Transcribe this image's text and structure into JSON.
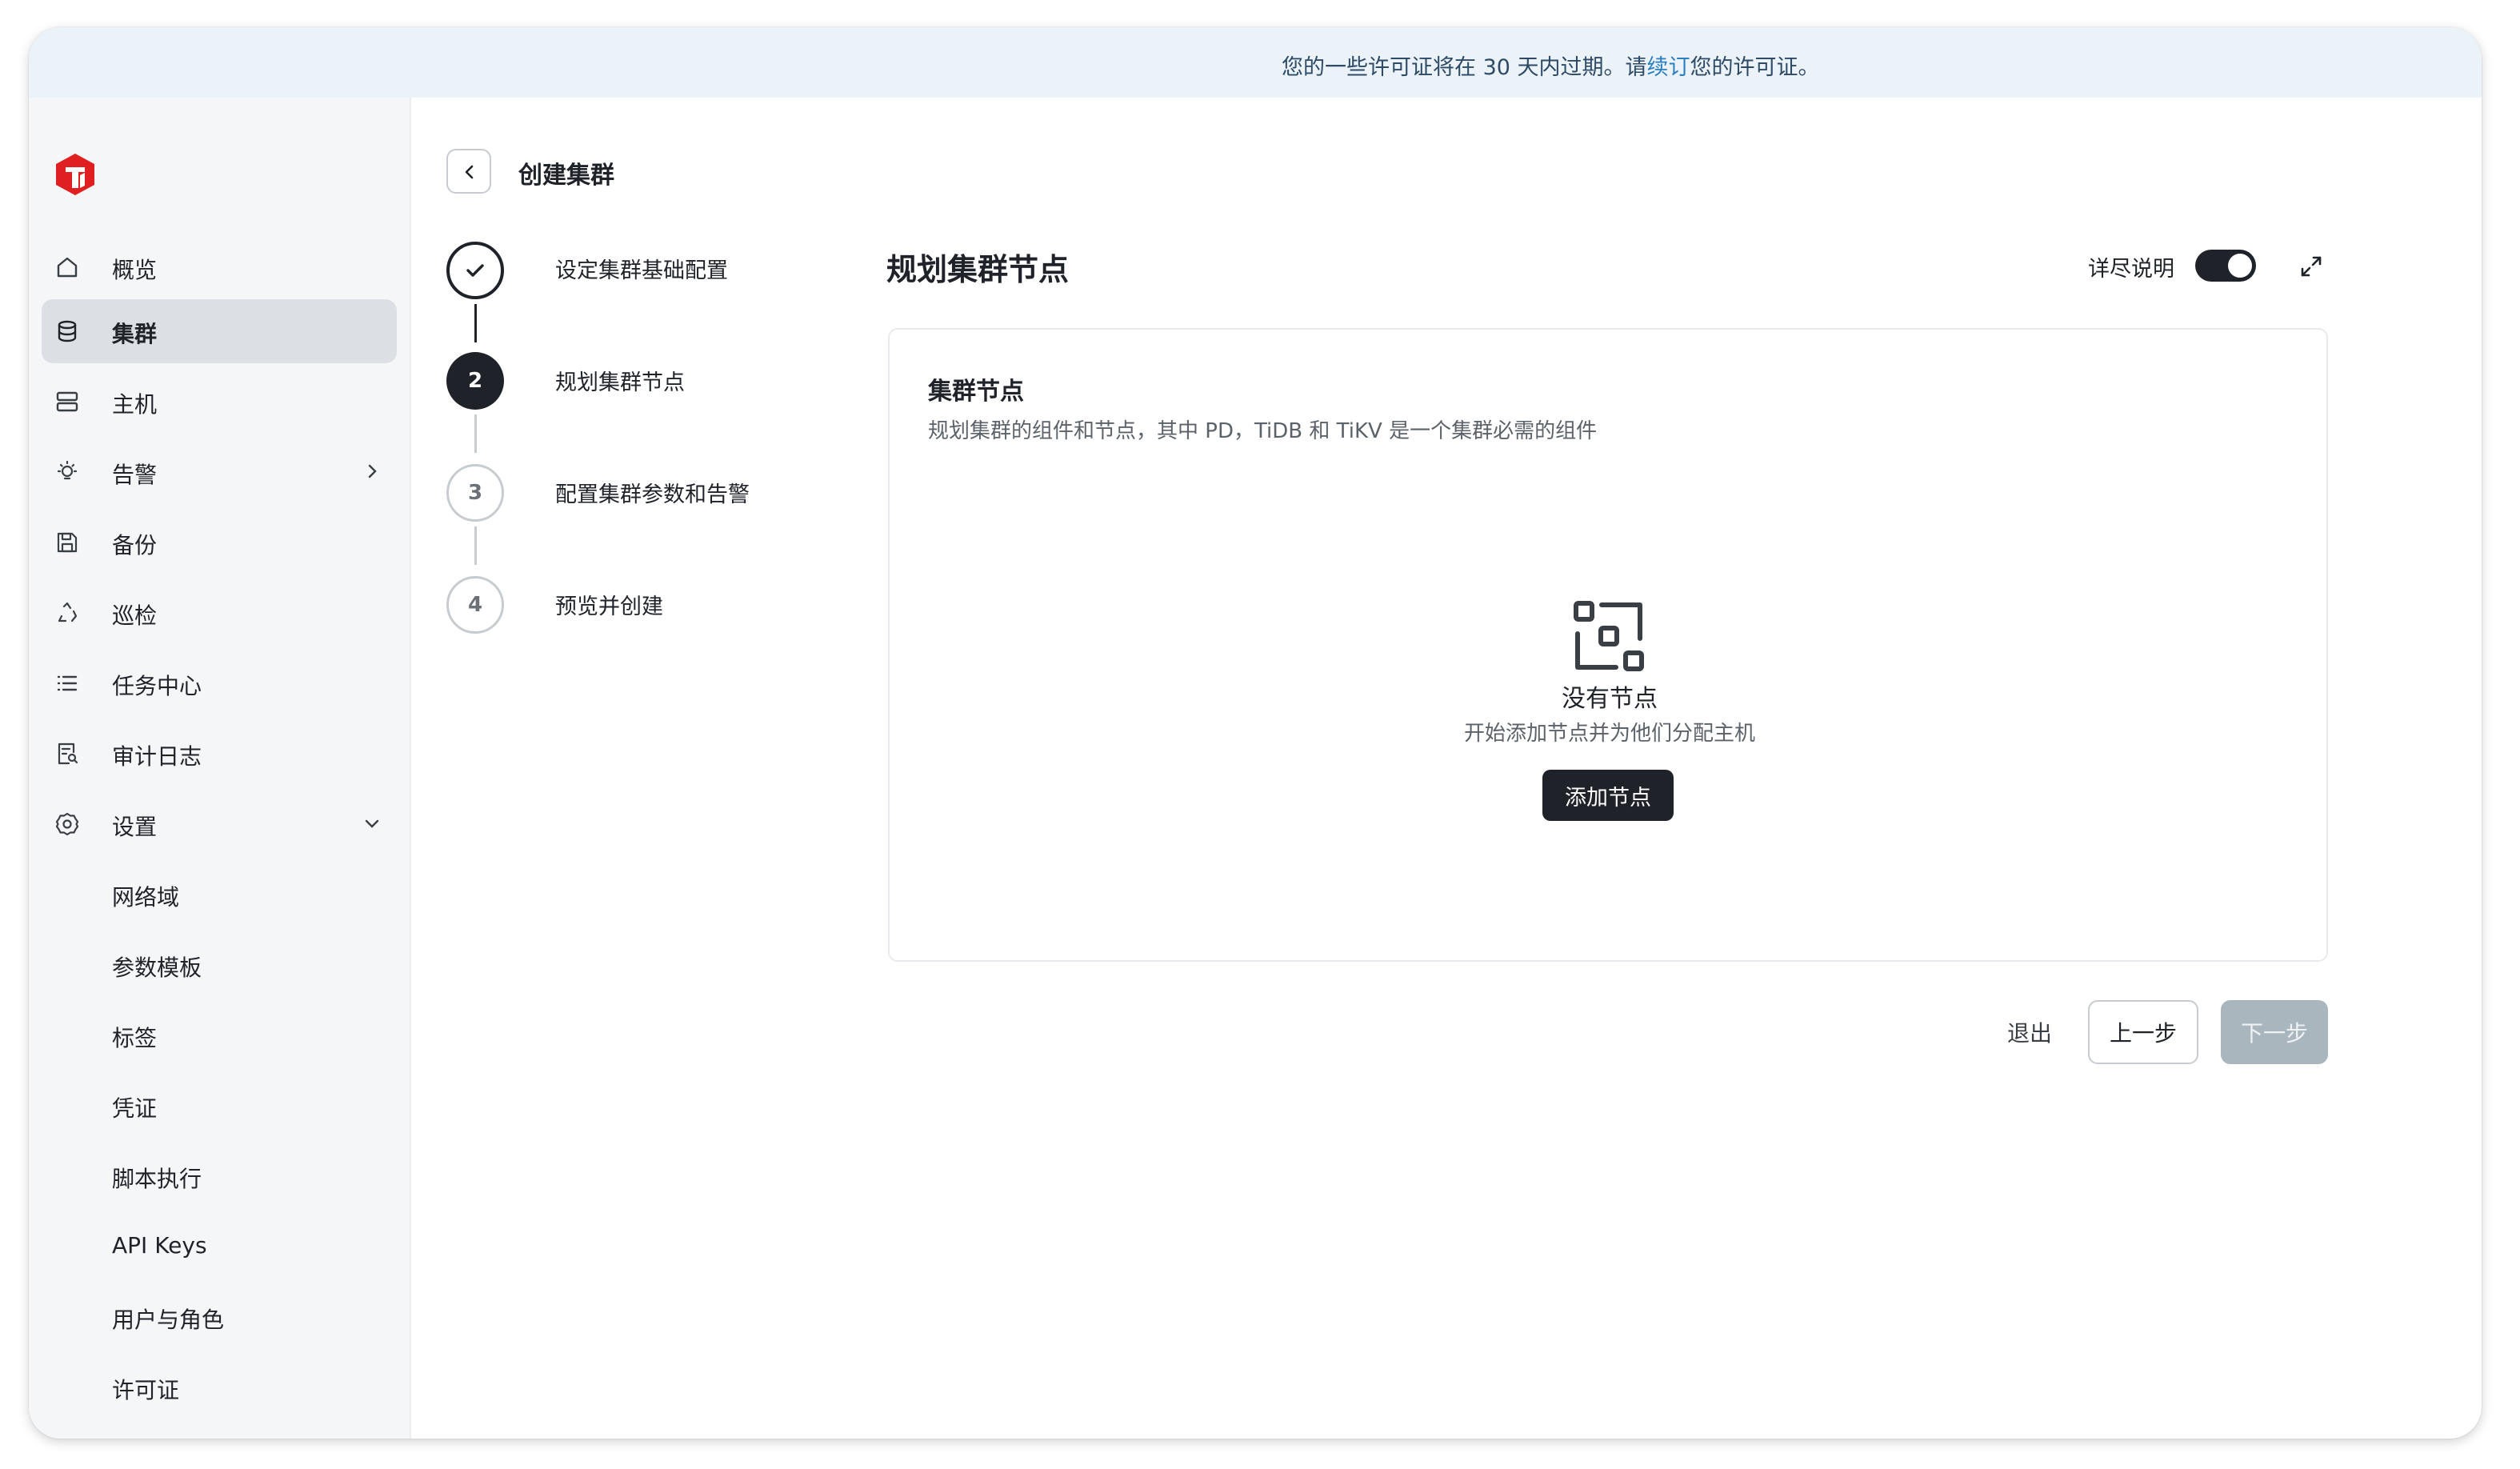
{
  "banner": {
    "text_before": "您的一些许可证将在 30 天内过期。请",
    "link": "续订",
    "text_after": "您的许可证。"
  },
  "colors": {
    "brand": "#e02020",
    "primary": "#1f2329",
    "banner_bg": "#ebf3f8",
    "link": "#2a7fc1",
    "disabled_button": "#a9b6bd"
  },
  "sidebar": {
    "logo_icon": "tidb-logo-icon",
    "items": [
      {
        "label": "概览",
        "icon": "home-icon"
      },
      {
        "label": "集群",
        "icon": "database-icon",
        "active": true
      },
      {
        "label": "主机",
        "icon": "server-icon"
      },
      {
        "label": "告警",
        "icon": "bulb-icon",
        "chevron": "chevron-right-icon"
      },
      {
        "label": "备份",
        "icon": "save-icon"
      },
      {
        "label": "巡检",
        "icon": "recycle-icon"
      },
      {
        "label": "任务中心",
        "icon": "list-icon"
      },
      {
        "label": "审计日志",
        "icon": "audit-log-icon"
      },
      {
        "label": "设置",
        "icon": "gear-icon",
        "chevron": "chevron-down-icon"
      }
    ],
    "settings_children": [
      {
        "label": "网络域"
      },
      {
        "label": "参数模板"
      },
      {
        "label": "标签"
      },
      {
        "label": "凭证"
      },
      {
        "label": "脚本执行"
      },
      {
        "label": "API Keys"
      },
      {
        "label": "用户与角色"
      },
      {
        "label": "许可证"
      }
    ]
  },
  "header": {
    "title": "创建集群"
  },
  "stepper": {
    "steps": [
      {
        "number": "1",
        "label": "设定集群基础配置",
        "status": "done"
      },
      {
        "number": "2",
        "label": "规划集群节点",
        "status": "current"
      },
      {
        "number": "3",
        "label": "配置集群参数和告警",
        "status": "pending"
      },
      {
        "number": "4",
        "label": "预览并创建",
        "status": "pending"
      }
    ]
  },
  "content": {
    "title": "规划集群节点",
    "detail_toggle_label": "详尽说明",
    "detail_toggle_on": true,
    "card": {
      "title": "集群节点",
      "subtitle": "规划集群的组件和节点，其中 PD，TiDB 和 TiKV 是一个集群必需的组件",
      "empty_title": "没有节点",
      "empty_desc": "开始添加节点并为他们分配主机",
      "add_button": "添加节点"
    }
  },
  "footer": {
    "exit": "退出",
    "prev": "上一步",
    "next": "下一步"
  }
}
